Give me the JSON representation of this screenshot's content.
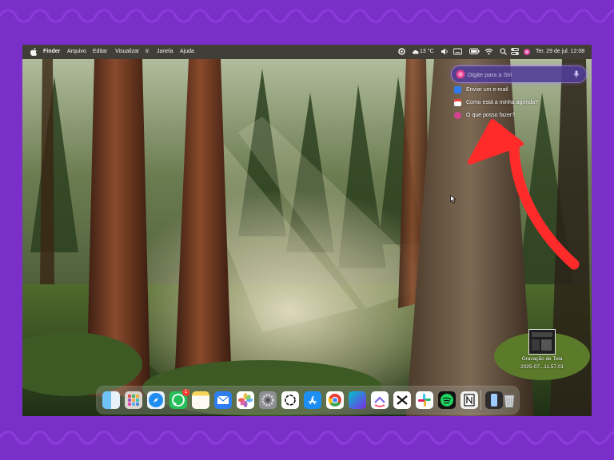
{
  "menubar": {
    "apple_icon": "apple-logo",
    "items": [
      "Finder",
      "Arquivo",
      "Editar",
      "Visualizar",
      "Ir",
      "Janela",
      "Ajuda"
    ],
    "weather": "13 °C",
    "datetime": "Ter. 29 de jul.  12:08",
    "status_icons": [
      "focus-icon",
      "weather-icon",
      "volume-icon",
      "keyboard-icon",
      "battery-icon",
      "wifi-icon",
      "search-icon",
      "control-center-icon",
      "siri-icon"
    ]
  },
  "siri": {
    "placeholder": "Digite para a Siri",
    "suggestions": [
      {
        "label": "Enviar um e-mail",
        "icon": "mail-icon"
      },
      {
        "label": "Como está a minha agenda?",
        "icon": "calendar-icon"
      },
      {
        "label": "O que posso fazer?",
        "icon": "siri-icon"
      }
    ]
  },
  "desktop": {
    "file_name_line1": "Gravação de Tela",
    "file_name_line2": "2025-07...11.57.01"
  },
  "dock": {
    "apps": [
      "Finder",
      "Launchpad",
      "Safari",
      "WhatsApp",
      "Notas",
      "Mail",
      "Fotos",
      "Ajustes do Sistema",
      "ChatGPT",
      "App Store",
      "Google Chrome",
      "Canva",
      "ClickUp",
      "CapCut",
      "Slack",
      "Spotify",
      "Notion",
      "iPhone Mirroring",
      "Lixo"
    ],
    "whatsapp_badge": "1"
  },
  "annotation": {
    "color": "#ff2b2b"
  }
}
